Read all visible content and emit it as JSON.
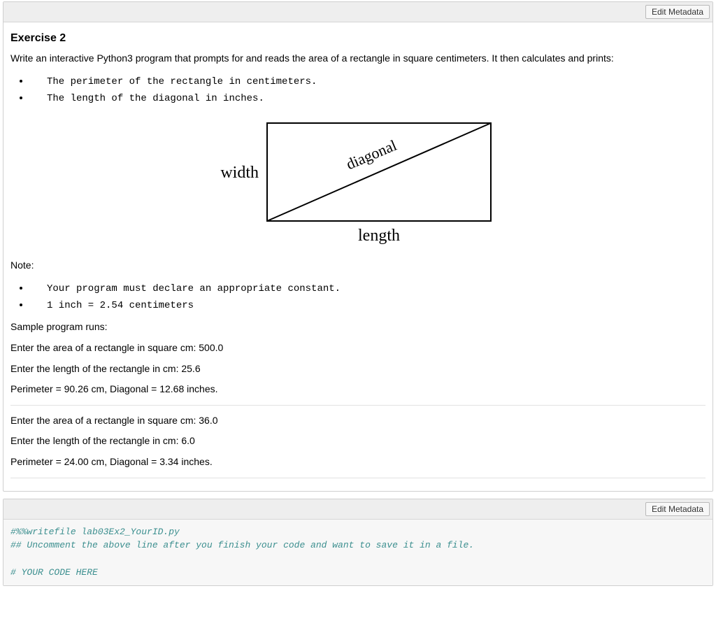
{
  "toolbar": {
    "edit_metadata": "Edit Metadata"
  },
  "exercise": {
    "title": "Exercise 2",
    "intro": "Write an interactive Python3 program that prompts for and reads the area of a rectangle in square centimeters. It then calculates and prints:",
    "tasks": [
      "The perimeter of the rectangle in centimeters.",
      "The length of the diagonal in inches."
    ],
    "diagram": {
      "width_label": "width",
      "length_label": "length",
      "diagonal_label": "diagonal"
    },
    "note_label": "Note:",
    "notes": [
      "Your program must declare an appropriate constant.",
      "1 inch = 2.54 centimeters"
    ],
    "sample_label": "Sample program runs:",
    "runs": [
      {
        "area_line": "Enter the area of a rectangle in square cm: 500.0",
        "length_line": "Enter the length of the rectangle in cm: 25.6",
        "result_line": "Perimeter = 90.26 cm, Diagonal = 12.68 inches."
      },
      {
        "area_line": "Enter the area of a rectangle in square cm: 36.0",
        "length_line": "Enter the length of the rectangle in cm: 6.0",
        "result_line": "Perimeter = 24.00 cm, Diagonal = 3.34 inches."
      }
    ]
  },
  "code_cell": {
    "line1": "#%%writefile lab03Ex2_YourID.py",
    "line2": "## Uncomment the above line after you finish your code and want to save it in a file.",
    "blank": "",
    "line3": "# YOUR CODE HERE"
  }
}
